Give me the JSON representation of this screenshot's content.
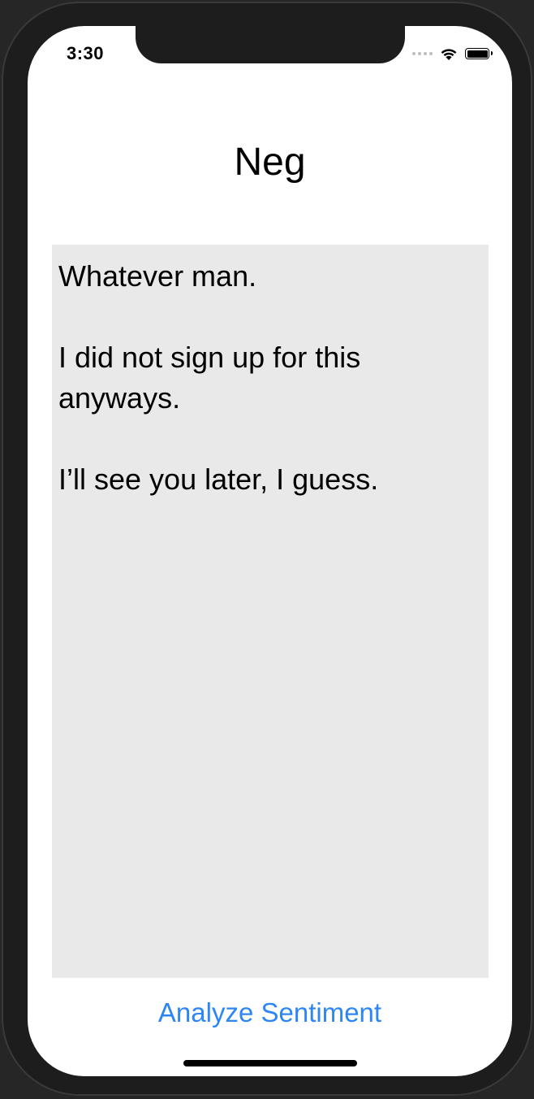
{
  "status_bar": {
    "time": "3:30",
    "icons": [
      "cellular-signal-icon",
      "wifi-icon",
      "battery-icon"
    ]
  },
  "navigation": {
    "title": "Neg"
  },
  "text_view": {
    "value": "Whatever man.\n\nI did not sign up for this anyways.\n\nI’ll see you later, I guess."
  },
  "actions": {
    "analyze_label": "Analyze Sentiment"
  },
  "colors": {
    "accent": "#2e86f5",
    "text_area_bg": "#e9e9e9",
    "frame": "#1d1d1d"
  }
}
